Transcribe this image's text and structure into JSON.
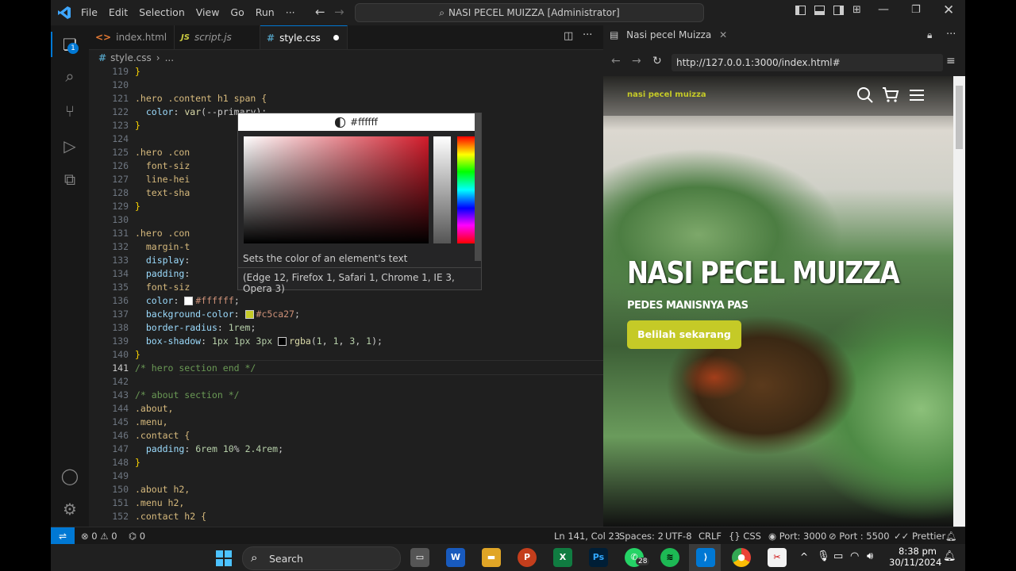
{
  "titlebar": {
    "menu": [
      "File",
      "Edit",
      "Selection",
      "View",
      "Go",
      "Run",
      "···"
    ],
    "command_center": "NASI PECEL MUIZZA [Administrator]"
  },
  "editor_tabs": [
    {
      "label": "index.html",
      "icon": "<>",
      "icon_color": "#e37933"
    },
    {
      "label": "script.js",
      "icon": "JS",
      "icon_color": "#cbcb41"
    },
    {
      "label": "style.css",
      "icon": "#",
      "icon_color": "#519aba"
    }
  ],
  "breadcrumb": {
    "file": "style.css",
    "rest": "..."
  },
  "code_lines": [
    {
      "n": "119",
      "t": "}"
    },
    {
      "n": "120",
      "t": ""
    },
    {
      "n": "121",
      "t": ".hero .content h1 span {"
    },
    {
      "n": "122",
      "t": "  color: var(--primary);"
    },
    {
      "n": "123",
      "t": "}"
    },
    {
      "n": "124",
      "t": ""
    },
    {
      "n": "125",
      "t": ".hero .con"
    },
    {
      "n": "126",
      "t": "  font-siz"
    },
    {
      "n": "127",
      "t": "  line-hei"
    },
    {
      "n": "128",
      "t": "  text-sha"
    },
    {
      "n": "129",
      "t": "}"
    },
    {
      "n": "130",
      "t": ""
    },
    {
      "n": "131",
      "t": ".hero .con"
    },
    {
      "n": "132",
      "t": "  margin-t"
    },
    {
      "n": "133",
      "t": "  display:"
    },
    {
      "n": "134",
      "t": "  padding:"
    },
    {
      "n": "135",
      "t": "  font-siz"
    },
    {
      "n": "136",
      "t": "  color: #ffffff;"
    },
    {
      "n": "137",
      "t": "  background-color: #c5ca27;"
    },
    {
      "n": "138",
      "t": "  border-radius: 1rem;"
    },
    {
      "n": "139",
      "t": "  box-shadow: 1px 1px 3px rgba(1, 1, 3, 1);"
    },
    {
      "n": "140",
      "t": "}"
    },
    {
      "n": "141",
      "t": "/* hero section end */"
    },
    {
      "n": "142",
      "t": ""
    },
    {
      "n": "143",
      "t": "/* about section */"
    },
    {
      "n": "144",
      "t": ".about,"
    },
    {
      "n": "145",
      "t": ".menu,"
    },
    {
      "n": "146",
      "t": ".contact {"
    },
    {
      "n": "147",
      "t": "  padding: 6rem 10% 2.4rem;"
    },
    {
      "n": "148",
      "t": "}"
    },
    {
      "n": "149",
      "t": ""
    },
    {
      "n": "150",
      "t": ".about h2,"
    },
    {
      "n": "151",
      "t": ".menu h2,"
    },
    {
      "n": "152",
      "t": ".contact h2 {"
    }
  ],
  "color_picker": {
    "value": "#ffffff",
    "description": "Sets the color of an element's text",
    "compat": "(Edge 12, Firefox 1, Safari 1, Chrome 1, IE 3, Opera 3)"
  },
  "statusbar": {
    "errors": "0",
    "warnings": "0",
    "ports_forwarded": "0",
    "position": "Ln 141, Col 23",
    "spaces": "Spaces: 2",
    "encoding": "UTF-8",
    "eol": "CRLF",
    "language": "CSS",
    "port_live": "Port: 3000",
    "port_off": "Port : 5500",
    "prettier": "Prettier"
  },
  "browser": {
    "tab_title": "Nasi pecel Muizza",
    "url": "http://127.0.0.1:3000/index.html#"
  },
  "site": {
    "logo": "nasi pecel muizza",
    "title": "NASI PECEL MUIZZA",
    "subtitle": "PEDES MANISNYA PAS",
    "cta": "Belilah sekarang",
    "accent": "#c5ca27"
  },
  "taskbar": {
    "search_placeholder": "Search",
    "whatsapp_badge": "28",
    "time": "8:38 pm",
    "date": "30/11/2024"
  }
}
